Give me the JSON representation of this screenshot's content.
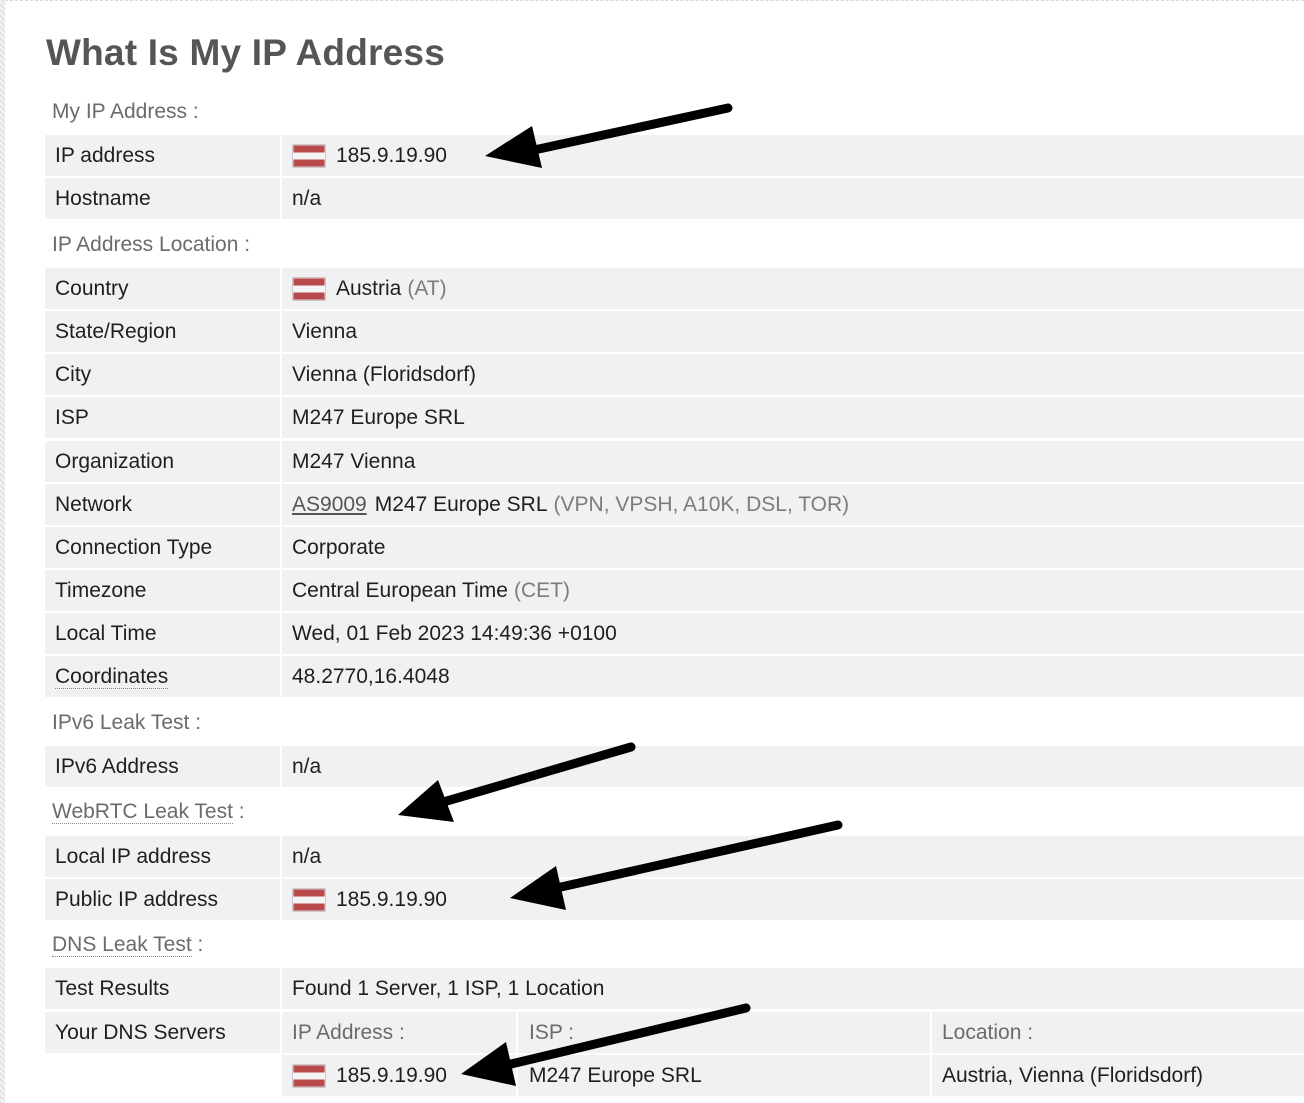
{
  "page": {
    "title": "What Is My IP Address"
  },
  "sections": {
    "my_ip": "My IP Address :",
    "location": "IP Address Location :",
    "ipv6": "IPv6 Leak Test :",
    "webrtc_label": "WebRTC Leak Test",
    "webrtc_colon": " :",
    "dns_label": "DNS Leak Test",
    "dns_colon": " :"
  },
  "my_ip": {
    "ip_label": "IP address",
    "ip_value": "185.9.19.90",
    "hostname_label": "Hostname",
    "hostname_value": "n/a"
  },
  "location": {
    "country_label": "Country",
    "country_value": "Austria",
    "country_code": "(AT)",
    "region_label": "State/Region",
    "region_value": "Vienna",
    "city_label": "City",
    "city_value": "Vienna (Floridsdorf)",
    "isp_label": "ISP",
    "isp_value": "M247 Europe SRL",
    "org_label": "Organization",
    "org_value": "M247 Vienna",
    "network_label": "Network",
    "network_as": "AS9009",
    "network_value": "M247 Europe SRL",
    "network_tags": "(VPN, VPSH, A10K, DSL, TOR)",
    "conn_label": "Connection Type",
    "conn_value": "Corporate",
    "tz_label": "Timezone",
    "tz_value": "Central European Time",
    "tz_abbr": "(CET)",
    "time_label": "Local Time",
    "time_value": "Wed, 01 Feb 2023 14:49:36 +0100",
    "coord_label": "Coordinates",
    "coord_value": "48.2770,16.4048"
  },
  "ipv6": {
    "addr_label": "IPv6 Address",
    "addr_value": "n/a"
  },
  "webrtc": {
    "local_label": "Local IP address",
    "local_value": "n/a",
    "public_label": "Public IP address",
    "public_value": "185.9.19.90"
  },
  "dns": {
    "results_label": "Test Results",
    "results_value": "Found 1 Server, 1 ISP, 1 Location",
    "servers_label": "Your DNS Servers",
    "col_ip": "IP Address :",
    "col_isp": "ISP :",
    "col_location": "Location :",
    "servers": [
      {
        "ip": "185.9.19.90",
        "isp": "M247 Europe SRL",
        "location": "Austria, Vienna (Floridsdorf)"
      }
    ]
  },
  "colors": {
    "flag_red": "#b84a4c",
    "row_bg": "#f1f1f3",
    "arrow": "#000000"
  }
}
